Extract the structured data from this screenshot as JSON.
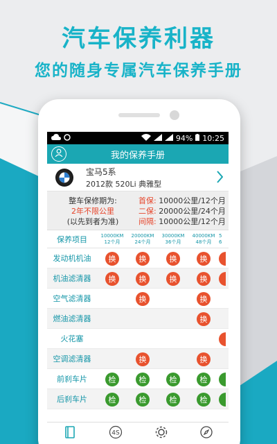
{
  "promo": {
    "title": "汽车保养利器",
    "subtitle": "您的随身专属汽车保养手册"
  },
  "statusbar": {
    "battery": "94%",
    "time": "10:25"
  },
  "header": {
    "title": "我的保养手册"
  },
  "car": {
    "name": "宝马5系",
    "model": "2012款 520Li 典雅型"
  },
  "warranty": {
    "label": "整车保修期为:",
    "value": "2年不限公里",
    "note": "(以先到者为准)",
    "first_label": "首保:",
    "first_value": "10000公里/12个月",
    "second_label": "二保:",
    "second_value": "20000公里/24个月",
    "interval_label": "间隔:",
    "interval_value": "10000公里/12个月"
  },
  "schedule": {
    "header_label": "保养项目",
    "columns": [
      {
        "km": "10000KM",
        "months": "12个月"
      },
      {
        "km": "20000KM",
        "months": "24个月"
      },
      {
        "km": "30000KM",
        "months": "36个月"
      },
      {
        "km": "40000KM",
        "months": "48个月"
      },
      {
        "km": "5",
        "months": "6"
      }
    ],
    "replace_text": "换",
    "check_text": "检",
    "rows": [
      {
        "item": "发动机机油",
        "cells": [
          "换",
          "换",
          "换",
          "换",
          "换"
        ]
      },
      {
        "item": "机油滤清器",
        "cells": [
          "换",
          "换",
          "换",
          "换",
          "换"
        ]
      },
      {
        "item": "空气滤清器",
        "cells": [
          "",
          "换",
          "",
          "换",
          ""
        ]
      },
      {
        "item": "燃油滤清器",
        "cells": [
          "",
          "",
          "",
          "换",
          ""
        ]
      },
      {
        "item": "火花塞",
        "cells": [
          "",
          "",
          "",
          "",
          "换"
        ]
      },
      {
        "item": "空调滤清器",
        "cells": [
          "",
          "换",
          "",
          "换",
          ""
        ]
      },
      {
        "item": "前刹车片",
        "cells": [
          "检",
          "检",
          "检",
          "检",
          "检"
        ]
      },
      {
        "item": "后刹车片",
        "cells": [
          "检",
          "检",
          "检",
          "检",
          "检"
        ]
      }
    ]
  },
  "bottomnav": {
    "items": [
      {
        "icon": "book-icon"
      },
      {
        "icon": "4s-icon",
        "label": "4S"
      },
      {
        "icon": "gear-icon"
      },
      {
        "icon": "compass-icon"
      }
    ]
  },
  "colors": {
    "accent": "#1ba7b3",
    "replace": "#e8522e",
    "check": "#3a9a2e",
    "warning": "#e6452b"
  }
}
